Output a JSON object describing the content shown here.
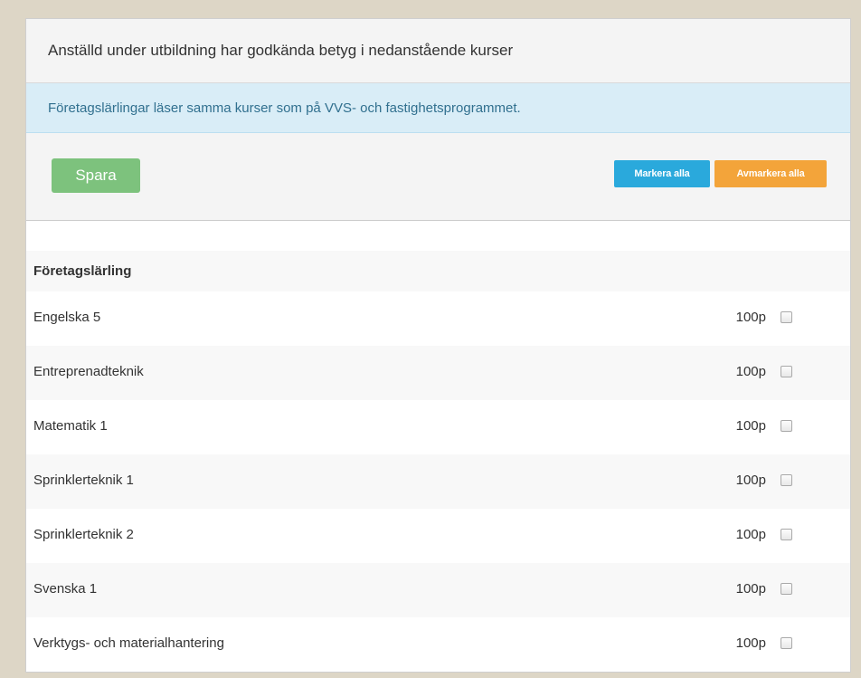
{
  "panel": {
    "title": "Anställd under utbildning har godkända betyg i nedanstående kurser",
    "info": "Företagslärlingar läser samma kurser som på VVS- och fastighetsprogrammet."
  },
  "toolbar": {
    "save_label": "Spara",
    "select_all_label": "Markera alla",
    "deselect_all_label": "Avmarkera alla"
  },
  "group": {
    "title": "Företagslärling"
  },
  "courses": [
    {
      "name": "Engelska 5",
      "points": "100p",
      "checked": false
    },
    {
      "name": "Entreprenadteknik",
      "points": "100p",
      "checked": false
    },
    {
      "name": "Matematik 1",
      "points": "100p",
      "checked": false
    },
    {
      "name": "Sprinklerteknik 1",
      "points": "100p",
      "checked": false
    },
    {
      "name": "Sprinklerteknik 2",
      "points": "100p",
      "checked": false
    },
    {
      "name": "Svenska 1",
      "points": "100p",
      "checked": false
    },
    {
      "name": "Verktygs- och materialhantering",
      "points": "100p",
      "checked": false
    }
  ],
  "colors": {
    "save_button": "#7dc27d",
    "select_all_button": "#2aa9dc",
    "deselect_all_button": "#f3a43a",
    "info_background": "#d9edf7",
    "info_text": "#31708f"
  }
}
